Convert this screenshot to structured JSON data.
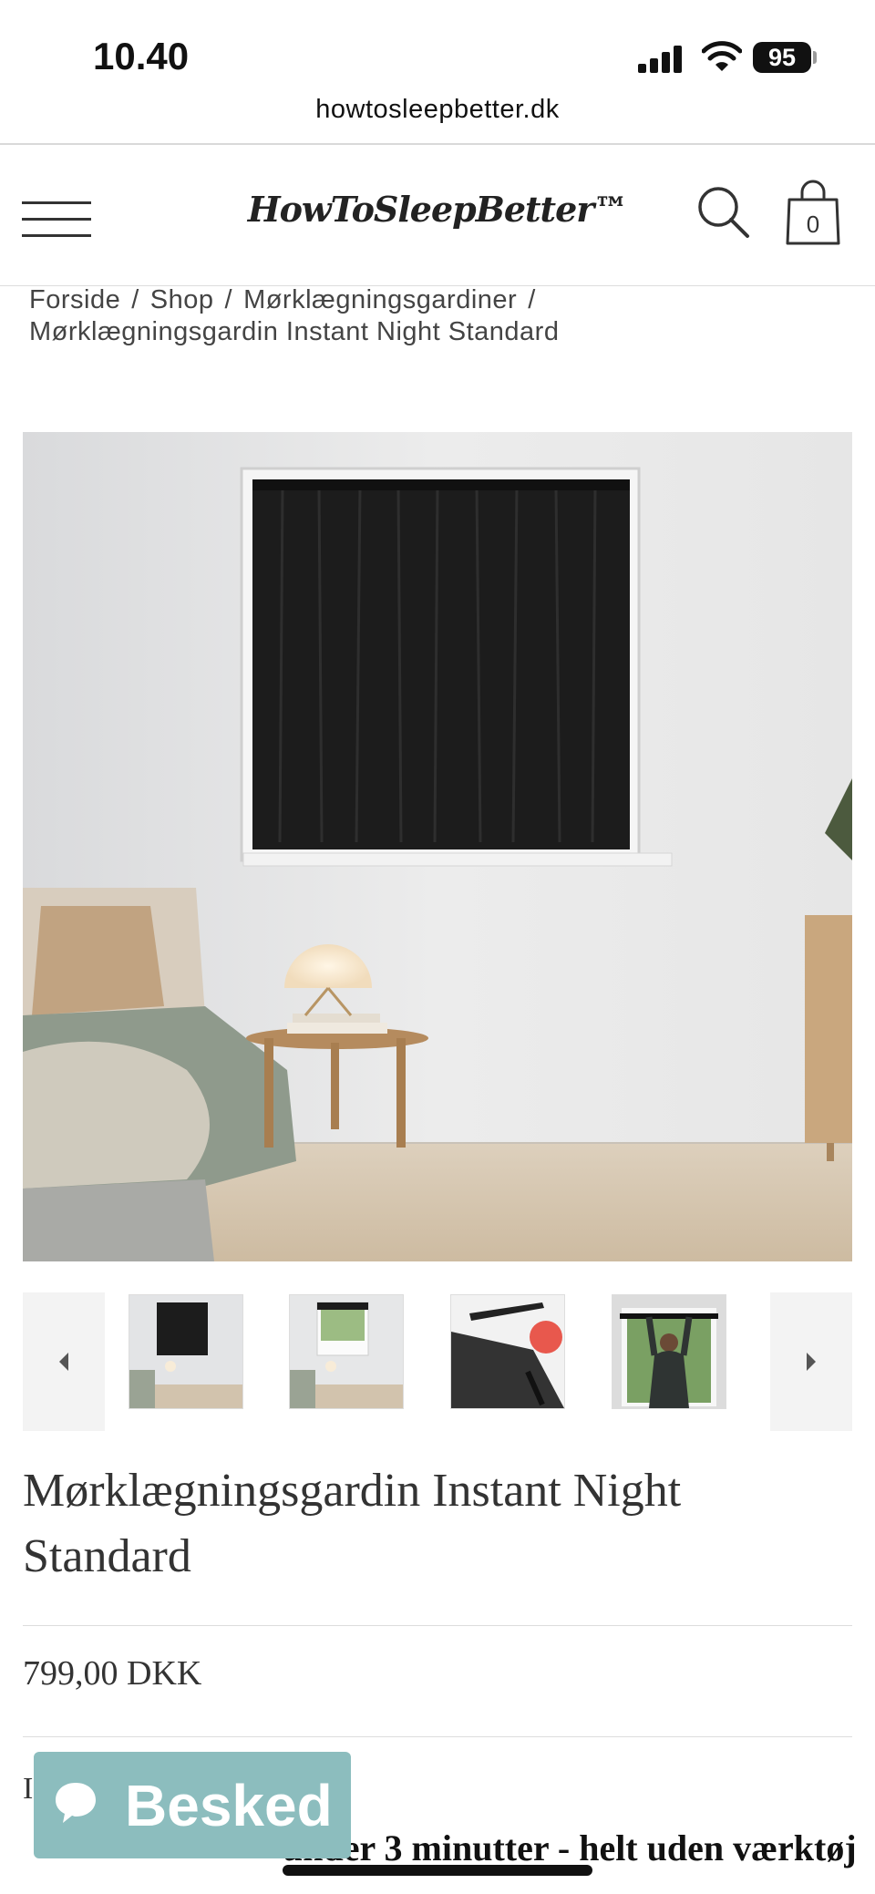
{
  "status_bar": {
    "time": "10.40",
    "battery": "95",
    "url": "howtosleepbetter.dk"
  },
  "header": {
    "logo": "HowToSleepBetter™",
    "cart_count": "0",
    "icons": [
      "menu-icon",
      "search-icon",
      "shopping-bag-icon"
    ]
  },
  "breadcrumb": {
    "items": [
      "Forside",
      "Shop",
      "Mørklægningsgardiner",
      "Mørklægningsgardin Instant Night Standard"
    ],
    "separator": "/"
  },
  "gallery": {
    "icons": [
      "arrow-left-icon",
      "arrow-right-icon"
    ]
  },
  "product": {
    "title": "Mørklægningsgardin Instant Night Standard",
    "price": "799,00 DKK",
    "description_stub": "I",
    "description_lead": "under 3 minutter - helt uden værktøj"
  },
  "chat": {
    "label": "Besked"
  },
  "colors": {
    "chat_button": "#8cbdbe",
    "text": "#333333",
    "curtain": "#1c1c1c"
  }
}
